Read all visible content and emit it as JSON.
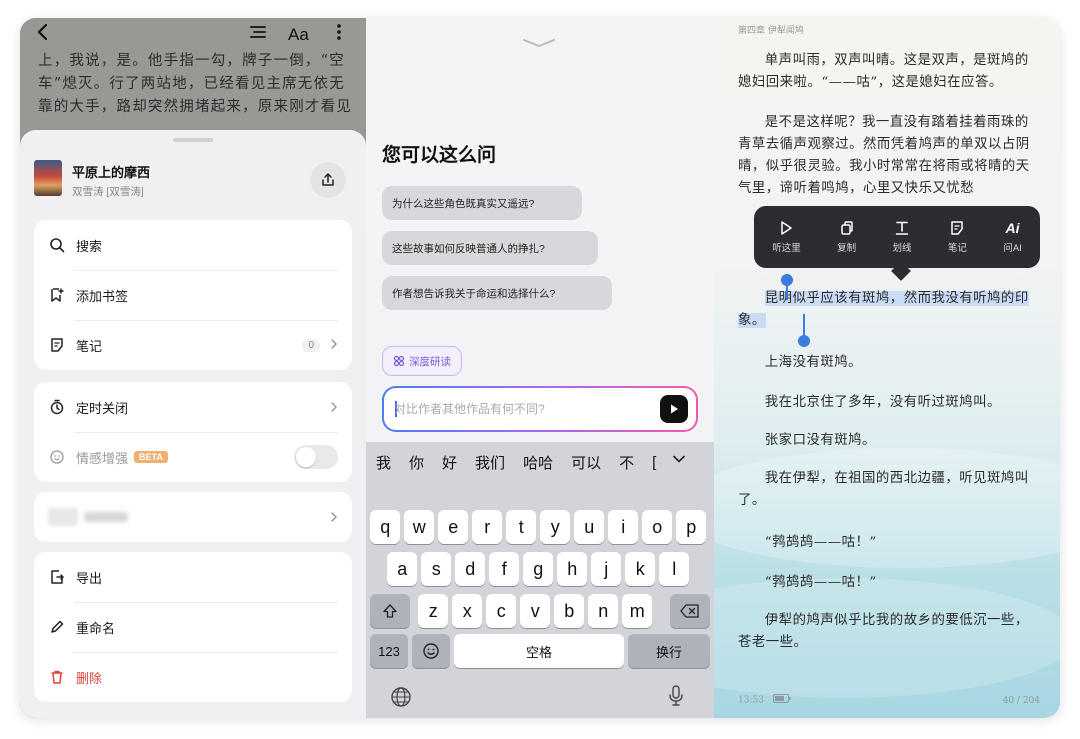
{
  "left": {
    "bg_text": "上，我说，是。他手指一勾，牌子一倒，“空车”熄灭。行了两站地，已经看见主席无依无靠的大手，路却突然拥堵起来，原来刚才看见",
    "book": {
      "title": "平原上的摩西",
      "author": "双雪涛 [双雪涛]"
    },
    "menu1": [
      {
        "label": "搜索"
      },
      {
        "label": "添加书签"
      },
      {
        "label": "笔记",
        "count": "0"
      }
    ],
    "timer_label": "定时关闭",
    "emotion_label": "情感增强",
    "beta_label": "BETA",
    "menu3": [
      {
        "label": "导出"
      },
      {
        "label": "重命名"
      },
      {
        "label": "删除"
      }
    ]
  },
  "middle": {
    "title": "您可以这么问",
    "suggestions": [
      "为什么这些角色既真实又遥远?",
      "这些故事如何反映普通人的挣扎?",
      "作者想告诉我关于命运和选择什么?"
    ],
    "deep_read": "深度研读",
    "input_placeholder": "对比作者其他作品有何不同?",
    "keyboard": {
      "candidates": [
        "我",
        "你",
        "好",
        "我们",
        "哈哈",
        "可以",
        "不",
        "["
      ],
      "row1": [
        "q",
        "w",
        "e",
        "r",
        "t",
        "y",
        "u",
        "i",
        "o",
        "p"
      ],
      "row2": [
        "a",
        "s",
        "d",
        "f",
        "g",
        "h",
        "j",
        "k",
        "l"
      ],
      "row3": [
        "z",
        "x",
        "c",
        "v",
        "b",
        "n",
        "m"
      ],
      "num_key": "123",
      "space_key": "空格",
      "return_key": "换行"
    }
  },
  "right": {
    "chapter": "第四章  伊犁闻鸠",
    "p1": "单声叫雨，双声叫晴。这是双声，是斑鸠的媳妇回来啦。“——咕”，这是媳妇在应答。",
    "p2": "是不是这样呢？我一直没有踏着挂着雨珠的青草去循声观察过。然而凭着鸠声的单双以占阴晴，似乎很灵验。我小时常常在将雨或将晴的天气里，谛听着鸣鸠，心里又快乐又忧愁",
    "p3": "昆明似乎应该有斑鸠，然而我没有听鸠的印象。",
    "p4": "上海没有斑鸠。",
    "p5": "我在北京住了多年，没有听过斑鸠叫。",
    "p6": "张家口没有斑鸠。",
    "p7": "我在伊犁，在祖国的西北边疆，听见斑鸠叫了。",
    "p8": "“鹁鸪鸪——咕！”",
    "p9": "“鹁鸪鸪——咕！”",
    "p10": "伊犁的鸠声似乎比我的故乡的要低沉一些，苍老一些。",
    "menu": [
      {
        "label": "听这里"
      },
      {
        "label": "复制"
      },
      {
        "label": "划线"
      },
      {
        "label": "笔记"
      },
      {
        "label": "问AI"
      }
    ],
    "time": "13:53",
    "page": "40 / 204"
  }
}
